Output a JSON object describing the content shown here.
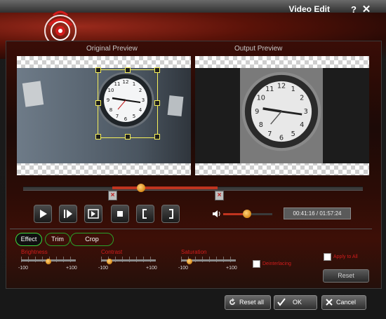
{
  "window": {
    "title": "Video Edit",
    "help_label": "?",
    "close_label": "✕"
  },
  "preview": {
    "original_label": "Original Preview",
    "output_label": "Output Preview"
  },
  "playback": {
    "time_current": "00:41:16",
    "time_total": "01:57:24",
    "time_display": "00:41:16 / 01:57:24",
    "timeline_position": 0.35,
    "trim_start": 0.26,
    "trim_end": 0.57,
    "volume": 0.48,
    "buttons": [
      "play-icon",
      "next-frame-icon",
      "snapshot-icon",
      "stop-icon",
      "mark-in-icon",
      "mark-out-icon"
    ]
  },
  "tabs": [
    {
      "label": "Effect",
      "selected": true
    },
    {
      "label": "Trim",
      "selected": false
    },
    {
      "label": "Crop",
      "selected": false
    }
  ],
  "effects": {
    "brightness": {
      "label": "Brightness",
      "min": "-100",
      "max": "+100",
      "value": 0
    },
    "contrast": {
      "label": "Contrast",
      "min": "-100",
      "max": "+100",
      "value": 0
    },
    "saturation": {
      "label": "Saturation",
      "min": "-100",
      "max": "+100",
      "value": 0
    },
    "deinterlacing_label": "Deinterlacing",
    "deinterlacing": false,
    "apply_to_all_label": "Apply to All",
    "apply_to_all": false,
    "reset_label": "Reset"
  },
  "footer": {
    "reset_all_label": "Reset all",
    "ok_label": "OK",
    "cancel_label": "Cancel"
  },
  "colors": {
    "accent_red": "#d21c1c",
    "tab_green": "#3dd93d",
    "slider_orange": "#d88a18"
  }
}
